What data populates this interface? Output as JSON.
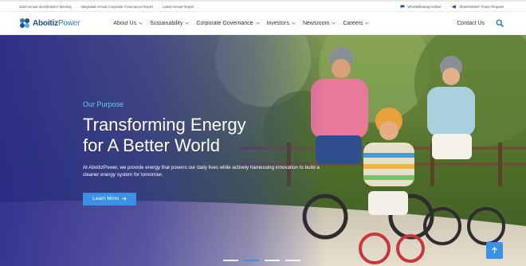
{
  "topbar": {
    "links": [
      "2022 Annual Stockholders' Meeting",
      "Integrated Annual Corporate Governance Report",
      "Latest Annual Report"
    ],
    "whistleblowing": "Whistleblowing Hotline",
    "power_request": "Shareholders' Power Request"
  },
  "nav": {
    "logo_main": "Aboitiz",
    "logo_accent": "Power",
    "items": [
      "About Us",
      "Sustainability",
      "Corporate Governance",
      "Investors",
      "Newsroom",
      "Careers"
    ],
    "contact": "Contact Us"
  },
  "hero": {
    "kicker": "Our Purpose",
    "headline_line1": "Transforming Energy",
    "headline_line2": "for A Better World",
    "description": "At AboitizPower, we provide energy that powers our daily lives while actively harnessing innovation to build a cleaner energy system for tomorrow.",
    "cta": "Learn More",
    "active_slide": 2,
    "slide_count": 4
  },
  "colors": {
    "accent": "#3a91e6",
    "kicker": "#5fd0ef",
    "overlay": "#2d2d8c",
    "brand": "#1f4f8c"
  },
  "icons": {
    "whistleblowing": "chat-bubble-icon",
    "power_request": "megaphone-icon",
    "search": "search-icon",
    "scroll_top": "arrow-up-icon",
    "cta": "arrow-right-icon"
  }
}
